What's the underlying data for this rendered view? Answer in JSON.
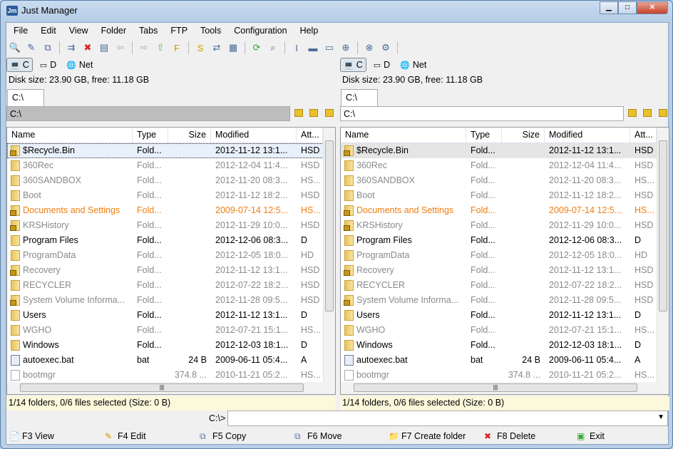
{
  "window": {
    "title": "Just Manager",
    "minimize": "▁",
    "maximize": "□",
    "close": "✕"
  },
  "menu": [
    "File",
    "Edit",
    "View",
    "Folder",
    "Tabs",
    "FTP",
    "Tools",
    "Configuration",
    "Help"
  ],
  "toolbar_icons": [
    "view-icon",
    "edit-icon",
    "copy-icon",
    "move-icon",
    "delete-icon",
    "properties-icon",
    "back-icon",
    "forward-icon",
    "up-folder-icon",
    "favorites-folder-icon",
    "special-folder-icon",
    "sync-icon",
    "view-mode-icon",
    "refresh-icon",
    "search-icon",
    "rename-icon",
    "console-icon",
    "window-icon",
    "map-drive-icon",
    "disconnect-drive-icon",
    "settings-icon"
  ],
  "panes": [
    {
      "drives": [
        "C",
        "D",
        "Net"
      ],
      "disk_info": "Disk size: 23.90 GB, free: 11.18 GB",
      "tab": "C:\\",
      "path": "C:\\",
      "status": "1/14 folders, 0/6 files selected (Size: 0 B)"
    },
    {
      "drives": [
        "C",
        "D",
        "Net"
      ],
      "disk_info": "Disk size: 23.90 GB, free: 11.18 GB",
      "tab": "C:\\",
      "path": "C:\\",
      "status": "1/14 folders, 0/6 files selected (Size: 0 B)"
    }
  ],
  "columns": [
    "Name",
    "Type",
    "Size",
    "Modified",
    "Att..."
  ],
  "files": [
    {
      "name": "$Recycle.Bin",
      "type": "Fold...",
      "size": "",
      "modified": "2012-11-12 13:1...",
      "attr": "HSD",
      "style": "black",
      "icon": "lock"
    },
    {
      "name": "360Rec",
      "type": "Fold...",
      "size": "",
      "modified": "2012-12-04 11:4...",
      "attr": "HSD",
      "style": "gray",
      "icon": "folder"
    },
    {
      "name": "360SANDBOX",
      "type": "Fold...",
      "size": "",
      "modified": "2012-11-20 08:3...",
      "attr": "HS...",
      "style": "gray",
      "icon": "folder"
    },
    {
      "name": "Boot",
      "type": "Fold...",
      "size": "",
      "modified": "2012-11-12 18:2...",
      "attr": "HSD",
      "style": "gray",
      "icon": "folder"
    },
    {
      "name": "Documents and Settings",
      "type": "Fold...",
      "size": "",
      "modified": "2009-07-14 12:5...",
      "attr": "HS...",
      "style": "orange",
      "icon": "lock"
    },
    {
      "name": "KRSHistory",
      "type": "Fold...",
      "size": "",
      "modified": "2012-11-29 10:0...",
      "attr": "HSD",
      "style": "gray",
      "icon": "lock"
    },
    {
      "name": "Program Files",
      "type": "Fold...",
      "size": "",
      "modified": "2012-12-06 08:3...",
      "attr": "D",
      "style": "black",
      "icon": "folder"
    },
    {
      "name": "ProgramData",
      "type": "Fold...",
      "size": "",
      "modified": "2012-12-05 18:0...",
      "attr": "HD",
      "style": "gray",
      "icon": "folder"
    },
    {
      "name": "Recovery",
      "type": "Fold...",
      "size": "",
      "modified": "2012-11-12 13:1...",
      "attr": "HSD",
      "style": "gray",
      "icon": "lock"
    },
    {
      "name": "RECYCLER",
      "type": "Fold...",
      "size": "",
      "modified": "2012-07-22 18:2...",
      "attr": "HSD",
      "style": "gray",
      "icon": "folder"
    },
    {
      "name": "System Volume Informa...",
      "type": "Fold...",
      "size": "",
      "modified": "2012-11-28 09:5...",
      "attr": "HSD",
      "style": "gray",
      "icon": "lock"
    },
    {
      "name": "Users",
      "type": "Fold...",
      "size": "",
      "modified": "2012-11-12 13:1...",
      "attr": "D",
      "style": "black",
      "icon": "folder"
    },
    {
      "name": "WGHO",
      "type": "Fold...",
      "size": "",
      "modified": "2012-07-21 15:1...",
      "attr": "HS...",
      "style": "gray",
      "icon": "folder"
    },
    {
      "name": "Windows",
      "type": "Fold...",
      "size": "",
      "modified": "2012-12-03 18:1...",
      "attr": "D",
      "style": "black",
      "icon": "folder"
    },
    {
      "name": "autoexec.bat",
      "type": "bat",
      "size": "24 B",
      "modified": "2009-06-11 05:4...",
      "attr": "A",
      "style": "black",
      "icon": "bat"
    },
    {
      "name": "bootmgr",
      "type": "",
      "size": "374.8 ...",
      "modified": "2010-11-21 05:2...",
      "attr": "HS...",
      "style": "gray",
      "icon": "file"
    }
  ],
  "command": {
    "prompt": "C:\\>",
    "value": ""
  },
  "fkeys": [
    "F3 View",
    "F4 Edit",
    "F5 Copy",
    "F6 Move",
    "F7 Create folder",
    "F8 Delete",
    "Exit"
  ]
}
